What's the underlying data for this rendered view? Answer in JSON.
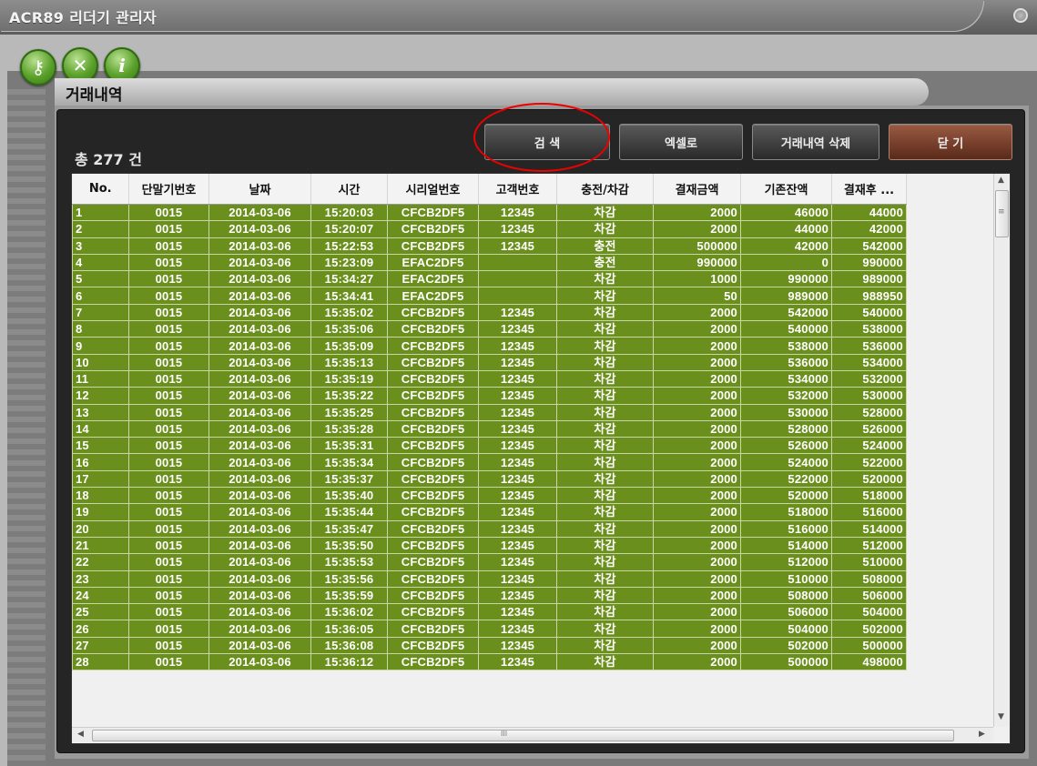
{
  "window": {
    "title": "ACR89 리더기 관리자"
  },
  "toolbar": {
    "icons": [
      "key-icon",
      "tools-icon",
      "info-icon"
    ],
    "info_glyph": "i",
    "key_glyph": "⚷",
    "tools_glyph": "✕"
  },
  "panel": {
    "title": "거래내역",
    "count_label": "총 277 건",
    "buttons": {
      "search": "검 색",
      "excel": "엑셀로",
      "delete": "거래내역 삭제",
      "close": "닫 기"
    }
  },
  "table": {
    "columns": [
      "No.",
      "단말기번호",
      "날짜",
      "시간",
      "시리얼번호",
      "고객번호",
      "충전/차감",
      "결재금액",
      "기존잔액",
      "결재후 ..."
    ],
    "rows": [
      [
        "1",
        "0015",
        "2014-03-06",
        "15:20:03",
        "CFCB2DF5",
        "12345",
        "차감",
        "2000",
        "46000",
        "44000"
      ],
      [
        "2",
        "0015",
        "2014-03-06",
        "15:20:07",
        "CFCB2DF5",
        "12345",
        "차감",
        "2000",
        "44000",
        "42000"
      ],
      [
        "3",
        "0015",
        "2014-03-06",
        "15:22:53",
        "CFCB2DF5",
        "12345",
        "충전",
        "500000",
        "42000",
        "542000"
      ],
      [
        "4",
        "0015",
        "2014-03-06",
        "15:23:09",
        "EFAC2DF5",
        "",
        "충전",
        "990000",
        "0",
        "990000"
      ],
      [
        "5",
        "0015",
        "2014-03-06",
        "15:34:27",
        "EFAC2DF5",
        "",
        "차감",
        "1000",
        "990000",
        "989000"
      ],
      [
        "6",
        "0015",
        "2014-03-06",
        "15:34:41",
        "EFAC2DF5",
        "",
        "차감",
        "50",
        "989000",
        "988950"
      ],
      [
        "7",
        "0015",
        "2014-03-06",
        "15:35:02",
        "CFCB2DF5",
        "12345",
        "차감",
        "2000",
        "542000",
        "540000"
      ],
      [
        "8",
        "0015",
        "2014-03-06",
        "15:35:06",
        "CFCB2DF5",
        "12345",
        "차감",
        "2000",
        "540000",
        "538000"
      ],
      [
        "9",
        "0015",
        "2014-03-06",
        "15:35:09",
        "CFCB2DF5",
        "12345",
        "차감",
        "2000",
        "538000",
        "536000"
      ],
      [
        "10",
        "0015",
        "2014-03-06",
        "15:35:13",
        "CFCB2DF5",
        "12345",
        "차감",
        "2000",
        "536000",
        "534000"
      ],
      [
        "11",
        "0015",
        "2014-03-06",
        "15:35:19",
        "CFCB2DF5",
        "12345",
        "차감",
        "2000",
        "534000",
        "532000"
      ],
      [
        "12",
        "0015",
        "2014-03-06",
        "15:35:22",
        "CFCB2DF5",
        "12345",
        "차감",
        "2000",
        "532000",
        "530000"
      ],
      [
        "13",
        "0015",
        "2014-03-06",
        "15:35:25",
        "CFCB2DF5",
        "12345",
        "차감",
        "2000",
        "530000",
        "528000"
      ],
      [
        "14",
        "0015",
        "2014-03-06",
        "15:35:28",
        "CFCB2DF5",
        "12345",
        "차감",
        "2000",
        "528000",
        "526000"
      ],
      [
        "15",
        "0015",
        "2014-03-06",
        "15:35:31",
        "CFCB2DF5",
        "12345",
        "차감",
        "2000",
        "526000",
        "524000"
      ],
      [
        "16",
        "0015",
        "2014-03-06",
        "15:35:34",
        "CFCB2DF5",
        "12345",
        "차감",
        "2000",
        "524000",
        "522000"
      ],
      [
        "17",
        "0015",
        "2014-03-06",
        "15:35:37",
        "CFCB2DF5",
        "12345",
        "차감",
        "2000",
        "522000",
        "520000"
      ],
      [
        "18",
        "0015",
        "2014-03-06",
        "15:35:40",
        "CFCB2DF5",
        "12345",
        "차감",
        "2000",
        "520000",
        "518000"
      ],
      [
        "19",
        "0015",
        "2014-03-06",
        "15:35:44",
        "CFCB2DF5",
        "12345",
        "차감",
        "2000",
        "518000",
        "516000"
      ],
      [
        "20",
        "0015",
        "2014-03-06",
        "15:35:47",
        "CFCB2DF5",
        "12345",
        "차감",
        "2000",
        "516000",
        "514000"
      ],
      [
        "21",
        "0015",
        "2014-03-06",
        "15:35:50",
        "CFCB2DF5",
        "12345",
        "차감",
        "2000",
        "514000",
        "512000"
      ],
      [
        "22",
        "0015",
        "2014-03-06",
        "15:35:53",
        "CFCB2DF5",
        "12345",
        "차감",
        "2000",
        "512000",
        "510000"
      ],
      [
        "23",
        "0015",
        "2014-03-06",
        "15:35:56",
        "CFCB2DF5",
        "12345",
        "차감",
        "2000",
        "510000",
        "508000"
      ],
      [
        "24",
        "0015",
        "2014-03-06",
        "15:35:59",
        "CFCB2DF5",
        "12345",
        "차감",
        "2000",
        "508000",
        "506000"
      ],
      [
        "25",
        "0015",
        "2014-03-06",
        "15:36:02",
        "CFCB2DF5",
        "12345",
        "차감",
        "2000",
        "506000",
        "504000"
      ],
      [
        "26",
        "0015",
        "2014-03-06",
        "15:36:05",
        "CFCB2DF5",
        "12345",
        "차감",
        "2000",
        "504000",
        "502000"
      ],
      [
        "27",
        "0015",
        "2014-03-06",
        "15:36:08",
        "CFCB2DF5",
        "12345",
        "차감",
        "2000",
        "502000",
        "500000"
      ],
      [
        "28",
        "0015",
        "2014-03-06",
        "15:36:12",
        "CFCB2DF5",
        "12345",
        "차감",
        "2000",
        "500000",
        "498000"
      ]
    ]
  },
  "scrollbar": {
    "up": "▲",
    "down": "▼",
    "left": "◀",
    "right": "▶",
    "grip": "≡",
    "hgrip": "III"
  },
  "colors": {
    "row_bg": "#6b8f1d",
    "accent": "#e00000"
  }
}
